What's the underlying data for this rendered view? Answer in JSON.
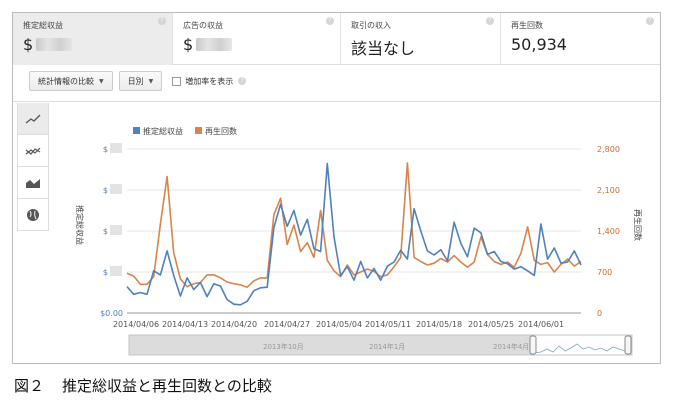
{
  "cards": [
    {
      "label": "推定総収益",
      "value": "$"
    },
    {
      "label": "広告の収益",
      "value": "$"
    },
    {
      "label": "取引の収入",
      "value": "該当なし"
    },
    {
      "label": "再生回数",
      "value": "50,934"
    }
  ],
  "help_glyph": "?",
  "toolbar": {
    "compare_label": "統計情報の比較",
    "daily_label": "日別",
    "growth_label": "増加率を表示"
  },
  "chart_tabs": [
    "line-chart-icon",
    "multi-line-chart-icon",
    "area-chart-icon",
    "globe-icon"
  ],
  "chart_data": {
    "type": "line",
    "legend": [
      "推定総収益",
      "再生回数"
    ],
    "colors": {
      "revenue": "#4f81bd",
      "views": "#d8844a"
    },
    "ylabel_left": "推定総収益",
    "ylabel_right": "再生回数",
    "left_ticks": [
      "$",
      "$",
      "$",
      "$",
      "$0.00"
    ],
    "right_ticks": [
      "2,800",
      "2,100",
      "1,400",
      "700",
      "0"
    ],
    "right_ylim": [
      0,
      2800
    ],
    "x_ticks": [
      "2014/04/06",
      "2014/04/13",
      "2014/04/20",
      "2014/04/27",
      "2014/05/04",
      "2014/05/11",
      "2014/05/18",
      "2014/05/25",
      "2014/06/01"
    ],
    "grid": true,
    "legend_position": "top-left",
    "series": [
      {
        "name": "推定総収益",
        "values": [
          450,
          320,
          350,
          320,
          720,
          650,
          1060,
          640,
          290,
          600,
          400,
          520,
          280,
          500,
          460,
          230,
          150,
          140,
          200,
          380,
          430,
          440,
          1460,
          1860,
          1480,
          1750,
          1330,
          1600,
          1100,
          1050,
          2550,
          1300,
          640,
          790,
          560,
          880,
          600,
          760,
          560,
          800,
          870,
          1070,
          920,
          1780,
          1400,
          1060,
          990,
          1080,
          890,
          1550,
          1190,
          960,
          1450,
          1370,
          1000,
          1050,
          880,
          840,
          750,
          790,
          720,
          640,
          1520,
          920,
          1110,
          850,
          870,
          1060,
          820
        ]
      },
      {
        "name": "再生回数",
        "values": [
          680,
          630,
          490,
          490,
          620,
          1520,
          2330,
          1030,
          580,
          450,
          500,
          520,
          650,
          650,
          600,
          530,
          500,
          480,
          440,
          550,
          600,
          600,
          1680,
          1960,
          1170,
          1500,
          1050,
          1200,
          950,
          1750,
          900,
          720,
          620,
          820,
          650,
          700,
          750,
          710,
          620,
          650,
          790,
          950,
          2560,
          950,
          880,
          820,
          850,
          930,
          870,
          980,
          870,
          780,
          870,
          1300,
          1000,
          880,
          830,
          870,
          780,
          1020,
          1470,
          900,
          830,
          860,
          700,
          830,
          920,
          800,
          880
        ]
      }
    ],
    "range_labels": [
      "2013年10月",
      "2014年1月",
      "2014年4月"
    ]
  },
  "caption": {
    "fig": "図２",
    "text": "推定総収益と再生回数との比較"
  }
}
